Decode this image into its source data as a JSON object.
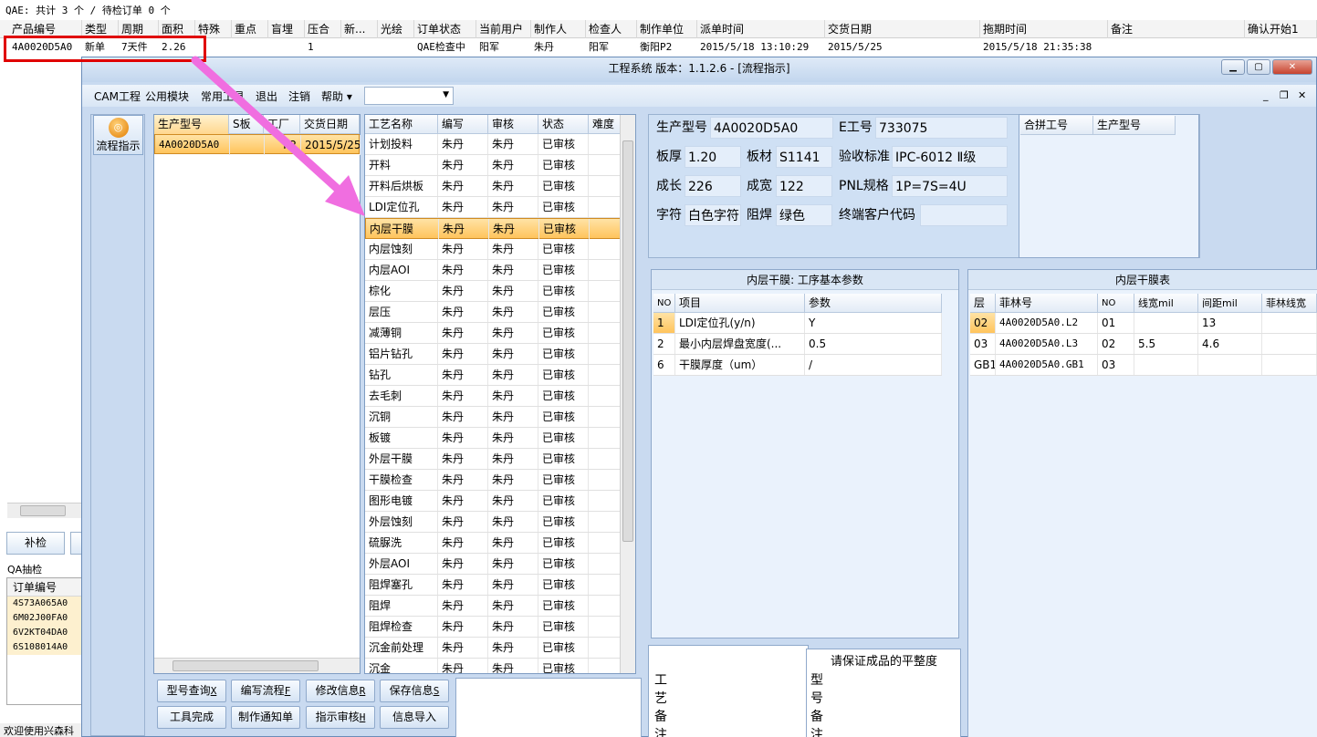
{
  "background": {
    "status_text": "QAE: 共计 3 个 / 待检订单 0 个",
    "columns": [
      "产品编号",
      "类型",
      "周期",
      "面积",
      "特殊",
      "重点",
      "盲埋",
      "压合",
      "新...",
      "光绘",
      "订单状态",
      "当前用户",
      "制作人",
      "检查人",
      "制作单位",
      "派单时间",
      "交货日期",
      "拖期时间",
      "备注",
      "确认开始1"
    ],
    "row": [
      "4A0020D5A0",
      "新单",
      "7天件",
      "2.26",
      "",
      "",
      "",
      "1",
      "",
      "",
      "QAE检查中",
      "阳军",
      "朱丹",
      "阳军",
      "衡阳P2",
      "2015/5/18 13:10:29",
      "2015/5/25",
      "2015/5/18 21:35:38",
      "",
      ""
    ],
    "buttons": [
      "补检"
    ],
    "qa_label": "QA抽检",
    "orders_header": "订单编号",
    "orders": [
      "4S73A065A0",
      "6M02J00FA0",
      "6V2KT04DA0",
      "6S108014A0"
    ],
    "welcome": "欢迎使用兴森科"
  },
  "window": {
    "title": "工程系统  版本：1.1.2.6 - [流程指示]",
    "menu": [
      "CAM工程",
      "公用模块",
      "常用工具",
      "退出",
      "注销",
      "帮助 ▾"
    ]
  },
  "sidebar": {
    "flow_button": "流程指示",
    "flow_icon_glyph": "◎"
  },
  "models": {
    "headers": [
      "生产型号",
      "S板",
      "工厂",
      "交货日期"
    ],
    "rows": [
      [
        "4A0020D5A0",
        "",
        "P2",
        "2015/5/25"
      ]
    ]
  },
  "process": {
    "headers": [
      "工艺名称",
      "编写",
      "审核",
      "状态",
      "难度"
    ],
    "selected_index": 4,
    "rows": [
      [
        "计划投料",
        "朱丹",
        "朱丹",
        "已审核"
      ],
      [
        "开料",
        "朱丹",
        "朱丹",
        "已审核"
      ],
      [
        "开料后烘板",
        "朱丹",
        "朱丹",
        "已审核"
      ],
      [
        "LDI定位孔",
        "朱丹",
        "朱丹",
        "已审核"
      ],
      [
        "内层干膜",
        "朱丹",
        "朱丹",
        "已审核"
      ],
      [
        "内层蚀刻",
        "朱丹",
        "朱丹",
        "已审核"
      ],
      [
        "内层AOI",
        "朱丹",
        "朱丹",
        "已审核"
      ],
      [
        "棕化",
        "朱丹",
        "朱丹",
        "已审核"
      ],
      [
        "层压",
        "朱丹",
        "朱丹",
        "已审核"
      ],
      [
        "减薄铜",
        "朱丹",
        "朱丹",
        "已审核"
      ],
      [
        "铝片钻孔",
        "朱丹",
        "朱丹",
        "已审核"
      ],
      [
        "钻孔",
        "朱丹",
        "朱丹",
        "已审核"
      ],
      [
        "去毛刺",
        "朱丹",
        "朱丹",
        "已审核"
      ],
      [
        "沉铜",
        "朱丹",
        "朱丹",
        "已审核"
      ],
      [
        "板镀",
        "朱丹",
        "朱丹",
        "已审核"
      ],
      [
        "外层干膜",
        "朱丹",
        "朱丹",
        "已审核"
      ],
      [
        "干膜检查",
        "朱丹",
        "朱丹",
        "已审核"
      ],
      [
        "图形电镀",
        "朱丹",
        "朱丹",
        "已审核"
      ],
      [
        "外层蚀刻",
        "朱丹",
        "朱丹",
        "已审核"
      ],
      [
        "硫脲洗",
        "朱丹",
        "朱丹",
        "已审核"
      ],
      [
        "外层AOI",
        "朱丹",
        "朱丹",
        "已审核"
      ],
      [
        "阻焊塞孔",
        "朱丹",
        "朱丹",
        "已审核"
      ],
      [
        "阻焊",
        "朱丹",
        "朱丹",
        "已审核"
      ],
      [
        "阻焊检查",
        "朱丹",
        "朱丹",
        "已审核"
      ],
      [
        "沉金前处理",
        "朱丹",
        "朱丹",
        "已审核"
      ],
      [
        "沉金",
        "朱丹",
        "朱丹",
        "已审核"
      ]
    ]
  },
  "info": {
    "model_label": "生产型号",
    "model_value": "4A0020D5A0",
    "e_label": "E工号",
    "e_value": "733075",
    "thickness_label": "板厚",
    "thickness_value": "1.20",
    "material_label": "板材",
    "material_value": "S1141",
    "standard_label": "验收标准",
    "standard_value": "IPC-6012 Ⅱ级",
    "length_label": "成长",
    "length_value": "226",
    "width_label": "成宽",
    "width_value": "122",
    "pnl_label": "PNL规格",
    "pnl_value": "1P=7S=4U",
    "char_label": "字符",
    "char_value": "白色字符",
    "mask_label": "阻焊",
    "mask_value": "绿色",
    "client_label": "终端客户代码",
    "client_value": ""
  },
  "merge": {
    "headers": [
      "合拼工号",
      "生产型号"
    ]
  },
  "params": {
    "title": "内层干膜: 工序基本参数",
    "headers": [
      "NO",
      "项目",
      "参数"
    ],
    "rows": [
      [
        "1",
        "LDI定位孔(y/n)",
        "Y"
      ],
      [
        "2",
        "最小内层焊盘宽度(...",
        "0.5"
      ],
      [
        "6",
        "干膜厚度（um）",
        "/"
      ]
    ]
  },
  "film": {
    "title": "内层干膜表",
    "headers": [
      "层",
      "菲林号",
      "NO",
      "线宽mil",
      "间距mil",
      "菲林线宽"
    ],
    "rows": [
      [
        "02",
        "4A0020D5A0.L2",
        "01",
        "",
        "13",
        ""
      ],
      [
        "03",
        "4A0020D5A0.L3",
        "02",
        "5.5",
        "4.6",
        ""
      ],
      [
        "GB1",
        "4A0020D5A0.GB1",
        "03",
        "",
        "",
        ""
      ]
    ]
  },
  "buttons": {
    "row1": [
      "型号查询",
      "编写流程",
      "修改信息",
      "保存信息"
    ],
    "row1_keys": [
      "X",
      "F",
      "R",
      "S"
    ],
    "row2": [
      "工具完成",
      "制作通知单",
      "指示审核",
      "信息导入"
    ],
    "row2_keys": [
      "",
      "",
      "H",
      ""
    ]
  },
  "notes": {
    "process_note_label": "工艺备注",
    "model_note_label": "型号备注",
    "model_note_text": "请保证成品的平整度"
  },
  "colors": {
    "selection": "#ffc45c",
    "highlight_box": "#e00000",
    "arrow": "#f06ee0"
  }
}
